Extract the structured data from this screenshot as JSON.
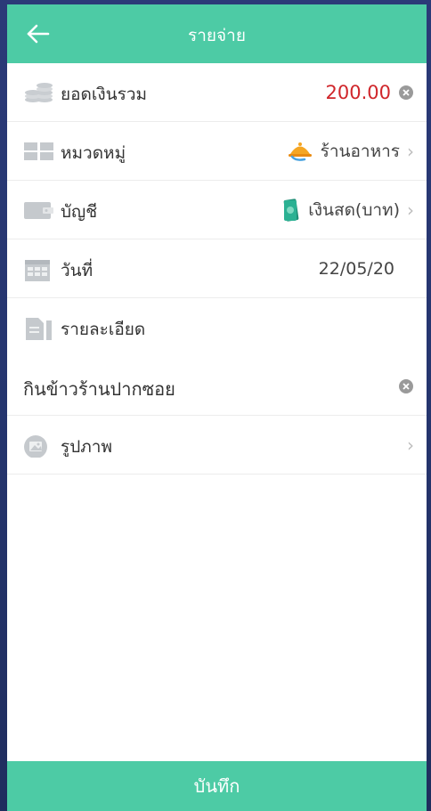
{
  "header": {
    "title": "รายจ่าย",
    "back_icon": "arrow-left-icon",
    "color": "#4dcba5"
  },
  "rows": {
    "total": {
      "label": "ยอดเงินรวม",
      "value": "200.00",
      "icon": "coins-icon",
      "value_color": "#d0262b"
    },
    "category": {
      "label": "หมวดหมู่",
      "value": "ร้านอาหาร",
      "icon": "grid-icon",
      "value_icon": "food-cloche-icon"
    },
    "account": {
      "label": "บัญชี",
      "value": "เงินสด(บาท)",
      "icon": "wallet-icon",
      "value_icon": "cash-icon"
    },
    "date": {
      "label": "วันที่",
      "value": "22/05/20",
      "icon": "calendar-icon"
    },
    "detail": {
      "label": "รายละเอียด",
      "icon": "document-icon"
    },
    "note": {
      "value": "กินข้าวร้านปากซอย"
    },
    "photo": {
      "label": "รูปภาพ",
      "icon": "image-icon"
    }
  },
  "footer": {
    "save_label": "บันทึก"
  }
}
